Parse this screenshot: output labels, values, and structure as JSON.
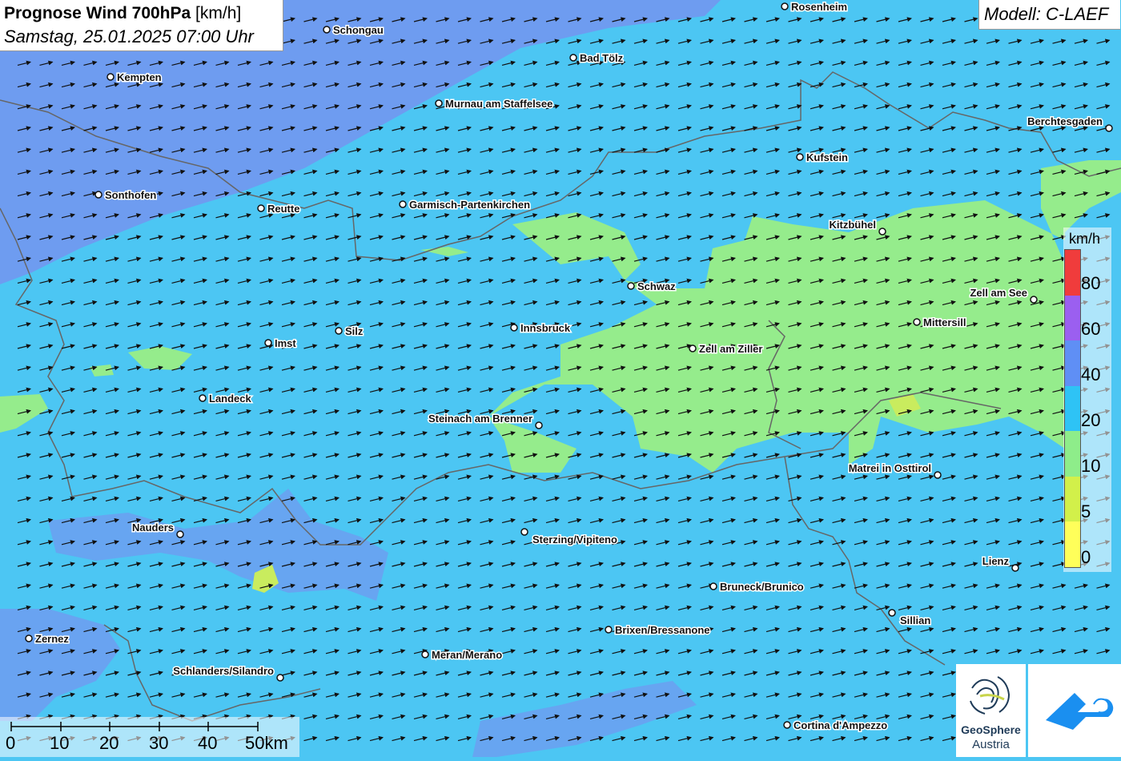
{
  "header": {
    "title_bold": "Prognose Wind 700hPa",
    "title_unit": "[km/h]",
    "subtitle": "Samstag, 25.01.2025 07:00 Uhr"
  },
  "model": {
    "label": "Modell: C-LAEF"
  },
  "legend": {
    "unit": "km/h",
    "labels": [
      "80",
      "60",
      "40",
      "20",
      "10",
      "5",
      "0"
    ],
    "colors": [
      "#f03c3c",
      "#9b5ff0",
      "#5f8ff5",
      "#2ec3f5",
      "#8eed8a",
      "#d2f04a",
      "#ffff5a"
    ]
  },
  "scale": {
    "labels": [
      "0",
      "10",
      "20",
      "30",
      "40",
      "50km"
    ]
  },
  "cities": [
    {
      "name": "Rosenheim"
    },
    {
      "name": "Schongau"
    },
    {
      "name": "Bad Tölz"
    },
    {
      "name": "Kempten"
    },
    {
      "name": "Murnau am Staffelsee"
    },
    {
      "name": "Berchtesgaden"
    },
    {
      "name": "Kufstein"
    },
    {
      "name": "Sonthofen"
    },
    {
      "name": "Reutte"
    },
    {
      "name": "Garmisch-Partenkirchen"
    },
    {
      "name": "Kitzbühel"
    },
    {
      "name": "Schwaz"
    },
    {
      "name": "Zell am See"
    },
    {
      "name": "Mittersill"
    },
    {
      "name": "Silz"
    },
    {
      "name": "Innsbruck"
    },
    {
      "name": "Imst"
    },
    {
      "name": "Zell am Ziller"
    },
    {
      "name": "Landeck"
    },
    {
      "name": "Steinach am Brenner"
    },
    {
      "name": "Matrei in Osttirol"
    },
    {
      "name": "Nauders"
    },
    {
      "name": "Sterzing/Vipiteno"
    },
    {
      "name": "Lienz"
    },
    {
      "name": "Bruneck/Brunico"
    },
    {
      "name": "Sillian"
    },
    {
      "name": "Zernez"
    },
    {
      "name": "Brixen/Bressanone"
    },
    {
      "name": "Meran/Merano"
    },
    {
      "name": "Schlanders/Silandro"
    },
    {
      "name": "Cortina d'Ampezzo"
    }
  ],
  "logos": {
    "geosphere_line1": "GeoSphere",
    "geosphere_line2": "Austria"
  },
  "colors": {
    "background_20_40": "#4cc6f3",
    "band_40_60": "#6e9cf0",
    "band_10_20": "#95ec8c",
    "band_5_10": "#c9ec5e"
  }
}
